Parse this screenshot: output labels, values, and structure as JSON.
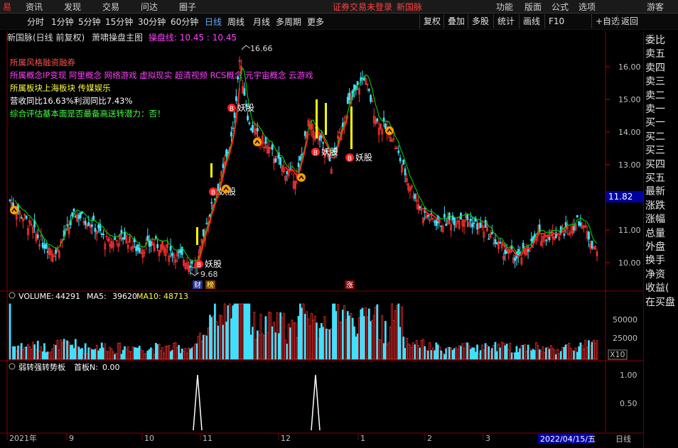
{
  "menubar": {
    "items": [
      "易",
      "资讯",
      "发现",
      "交易",
      "问达",
      "圈子"
    ],
    "notice": "证券交易未登录",
    "stock_name": "新国脉",
    "right_items": [
      "功能",
      "版面",
      "公式",
      "选项"
    ],
    "guest": "游客",
    "r_icon": "R"
  },
  "toolbar": {
    "periods": [
      "分时",
      "1分钟",
      "5分钟",
      "15分钟",
      "30分钟",
      "60分钟",
      "日线",
      "周线",
      "月线",
      "多周期",
      "更多"
    ],
    "active": "日线",
    "buttons": [
      "复权",
      "叠加",
      "多股",
      "统计",
      "画线",
      "F10",
      "+自选",
      "返回"
    ]
  },
  "chart_header": {
    "title": "新国脉(日线 前复权)",
    "indicator": "萧啸操盘主图",
    "line_label": "操盘线:",
    "line_value": "10.45 : 10.45"
  },
  "info_lines": [
    {
      "text": "所属风格融资融券",
      "color": "#ff5050"
    },
    {
      "text": "所属概念IP变现 阿里概念 网络游戏 虚拟现实 超清视频 RCS概念 元宇宙概念 云游戏",
      "color": "#ff40ff"
    },
    {
      "text": "所属板块上海板块 传媒娱乐",
      "color": "#ffff40"
    },
    {
      "text": "营收同比16.63%利润同比7.43%",
      "color": "#ffffff"
    },
    {
      "text": "综合评估基本面是否最备高送转潜力：否！",
      "color": "#40ff40"
    }
  ],
  "price_labels": {
    "high": "16.66",
    "low": "9.68",
    "current": "11.82"
  },
  "price_axis": [
    "16.00",
    "15.00",
    "14.00",
    "13.00",
    "12.00",
    "11.00",
    "10.00"
  ],
  "markers": {
    "yao": "妖股",
    "b": "B",
    "cai": "财",
    "bang": "榜",
    "zhang": "涨"
  },
  "volume_panel": {
    "label": "VOLUME:",
    "volume": "44291",
    "ma5_label": "MA5:",
    "ma5": "39620",
    "ma10_label": "MA10:",
    "ma10": "48713",
    "axis": [
      "50000",
      "25000"
    ],
    "unit": "X10"
  },
  "indicator_panel": {
    "label": "弱转强转势板",
    "param_label": "首板N:",
    "param": "0.00",
    "axis": [
      "1.00",
      "0.50"
    ]
  },
  "time_axis": [
    "2021年",
    "9",
    "10",
    "11",
    "12",
    "1",
    "2",
    "3"
  ],
  "date_label": "2022/04/15/五",
  "period_label": "日线",
  "sidebar_items": [
    "委比",
    "卖五",
    "卖四",
    "卖三",
    "卖二",
    "卖一",
    "买一",
    "买二",
    "买三",
    "买四",
    "买五",
    "最新",
    "涨跌",
    "涨幅",
    "总量",
    "外盘",
    "换手",
    "净资",
    "收益(",
    "在买盘"
  ],
  "colors": {
    "up": "#ff3030",
    "down": "#40e0ff",
    "yellow": "#ffff00",
    "green": "#00ff00",
    "magenta": "#ff40ff"
  }
}
